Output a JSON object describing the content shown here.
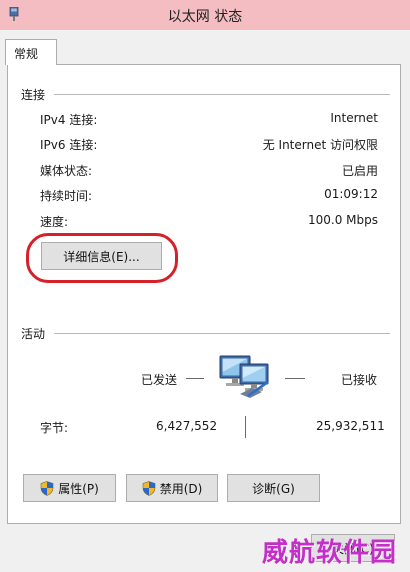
{
  "window": {
    "title": "以太网 状态"
  },
  "tabs": [
    {
      "label": "常规"
    }
  ],
  "connection": {
    "section_title": "连接",
    "rows": [
      {
        "label": "IPv4 连接:",
        "value": "Internet"
      },
      {
        "label": "IPv6 连接:",
        "value": "无 Internet 访问权限"
      },
      {
        "label": "媒体状态:",
        "value": "已启用"
      },
      {
        "label": "持续时间:",
        "value": "01:09:12"
      },
      {
        "label": "速度:",
        "value": "100.0 Mbps"
      }
    ],
    "details_button": "详细信息(E)..."
  },
  "activity": {
    "section_title": "活动",
    "sent_label": "已发送",
    "received_label": "已接收",
    "bytes_label": "字节:",
    "bytes_sent": "6,427,552",
    "bytes_received": "25,932,511"
  },
  "buttons": {
    "properties": "属性(P)",
    "disable": "禁用(D)",
    "diagnose": "诊断(G)",
    "close": "关闭(C)"
  },
  "watermark": "威航软件园",
  "colors": {
    "titlebar": "#f3bdc1",
    "highlight": "#d5222a",
    "watermark": "#c42ec9"
  }
}
